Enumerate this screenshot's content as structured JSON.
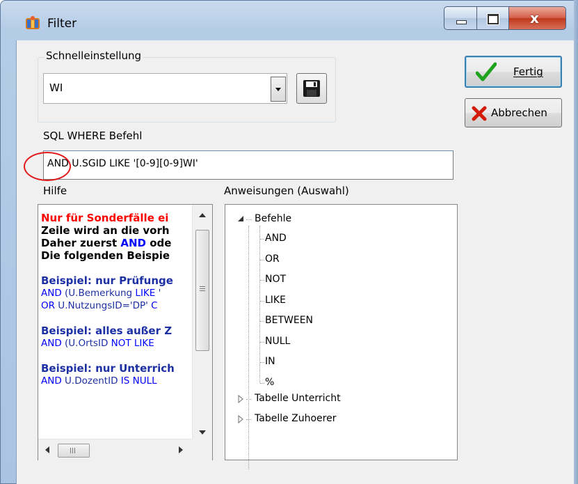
{
  "window": {
    "title": "Filter",
    "icon": "filter-app-icon"
  },
  "caption_buttons": {
    "minimize": "minimize-icon",
    "maximize": "maximize-icon",
    "close": "close-icon"
  },
  "quick_settings": {
    "group_label": "Schnelleinstellung",
    "selected_value": "WI"
  },
  "buttons": {
    "done": "Fertig",
    "cancel": "Abbrechen"
  },
  "sql": {
    "label": "SQL WHERE Befehl",
    "value": "AND U.SGID LIKE '[0-9][0-9]WI'"
  },
  "help": {
    "label": "Hilfe",
    "lines": [
      {
        "segments": [
          {
            "text": "Nur für Sonderfälle ei",
            "style": "bold-red"
          }
        ]
      },
      {
        "segments": [
          {
            "text": "Zeile wird an die vorh",
            "style": "bold"
          }
        ]
      },
      {
        "segments": [
          {
            "text": "Daher zuerst ",
            "style": "bold"
          },
          {
            "text": "AND",
            "style": "bold-blue"
          },
          {
            "text": " ode",
            "style": "bold"
          }
        ]
      },
      {
        "segments": [
          {
            "text": "Die folgenden Beispie",
            "style": "bold"
          }
        ]
      },
      {
        "segments": [
          {
            "text": "",
            "style": "plain"
          }
        ]
      },
      {
        "segments": [
          {
            "text": "Beispiel: nur Prüfunge",
            "style": "bold-navy"
          }
        ]
      },
      {
        "segments": [
          {
            "text": "AND",
            "style": "blue"
          },
          {
            "text": " (U.Bemerkung ",
            "style": "plain"
          },
          {
            "text": "LIKE",
            "style": "blue"
          },
          {
            "text": " '",
            "style": "plain"
          }
        ]
      },
      {
        "segments": [
          {
            "text": " OR",
            "style": "blue"
          },
          {
            "text": " U.NutzungsID='DP' ",
            "style": "plain"
          },
          {
            "text": "C",
            "style": "blue"
          }
        ]
      },
      {
        "segments": [
          {
            "text": "",
            "style": "plain"
          }
        ]
      },
      {
        "segments": [
          {
            "text": "Beispiel: alles außer Z",
            "style": "bold-navy"
          }
        ]
      },
      {
        "segments": [
          {
            "text": "AND",
            "style": "blue"
          },
          {
            "text": " (U.OrtsID ",
            "style": "plain"
          },
          {
            "text": "NOT LIKE",
            "style": "blue"
          }
        ]
      },
      {
        "segments": [
          {
            "text": "",
            "style": "plain"
          }
        ]
      },
      {
        "segments": [
          {
            "text": "Beispiel: nur Unterrich",
            "style": "bold-navy"
          }
        ]
      },
      {
        "segments": [
          {
            "text": "AND",
            "style": "blue"
          },
          {
            "text": " U.DozentID ",
            "style": "plain"
          },
          {
            "text": "IS NULL",
            "style": "blue"
          }
        ]
      }
    ]
  },
  "statements": {
    "label": "Anweisungen (Auswahl)",
    "root": "Befehle",
    "commands": [
      "AND",
      "OR",
      "NOT",
      "LIKE",
      "BETWEEN",
      "NULL",
      "IN",
      "%"
    ],
    "other_nodes": [
      "Tabelle Unterricht",
      "Tabelle Zuhoerer"
    ]
  },
  "colors": {
    "red": "#ff0000",
    "blue": "#0000ff",
    "navy": "#1c2fa3",
    "highlight_circle": "#e0191b",
    "done_check": "#1fa31f",
    "cancel_x": "#d21b0b"
  }
}
